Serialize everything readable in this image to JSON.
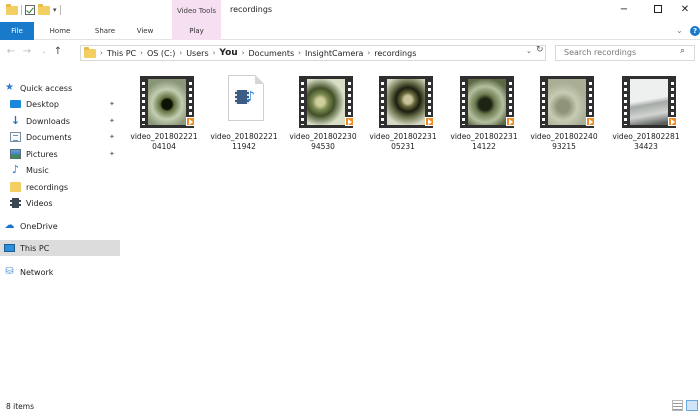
{
  "titlebar": {
    "context_tab": "Video Tools",
    "title": "recordings",
    "minimize": "−",
    "close": "✕"
  },
  "ribbon": {
    "tabs": [
      "File",
      "Home",
      "Share",
      "View",
      "Play"
    ],
    "help": "?"
  },
  "address": {
    "crumbs": [
      "This PC",
      "OS (C:)",
      "Users",
      "You",
      "Documents",
      "InsightCamera",
      "recordings"
    ],
    "search_placeholder": "Search recordings"
  },
  "sidebar": {
    "items": [
      {
        "label": "Quick access",
        "icon": "quick-access-star-icon"
      },
      {
        "label": "Desktop",
        "icon": "desktop-icon",
        "pinned": true
      },
      {
        "label": "Downloads",
        "icon": "downloads-icon",
        "pinned": true
      },
      {
        "label": "Documents",
        "icon": "documents-icon",
        "pinned": true
      },
      {
        "label": "Pictures",
        "icon": "pictures-icon",
        "pinned": true
      },
      {
        "label": "Music",
        "icon": "music-icon"
      },
      {
        "label": "recordings",
        "icon": "folder-icon"
      },
      {
        "label": "Videos",
        "icon": "videos-icon"
      },
      {
        "label": "OneDrive",
        "icon": "onedrive-icon"
      },
      {
        "label": "This PC",
        "icon": "this-pc-icon",
        "selected": true
      },
      {
        "label": "Network",
        "icon": "network-icon"
      }
    ]
  },
  "files": [
    {
      "line1": "video_201802221",
      "line2": "04104",
      "kind": "video"
    },
    {
      "line1": "video_201802221",
      "line2": "11942",
      "kind": "media-file"
    },
    {
      "line1": "video_201802230",
      "line2": "94530",
      "kind": "video"
    },
    {
      "line1": "video_201802231",
      "line2": "05231",
      "kind": "video"
    },
    {
      "line1": "video_201802231",
      "line2": "14122",
      "kind": "video"
    },
    {
      "line1": "video_201802240",
      "line2": "93215",
      "kind": "video"
    },
    {
      "line1": "video_201802281",
      "line2": "34423",
      "kind": "video"
    }
  ],
  "status": {
    "item_count": "8 items"
  }
}
